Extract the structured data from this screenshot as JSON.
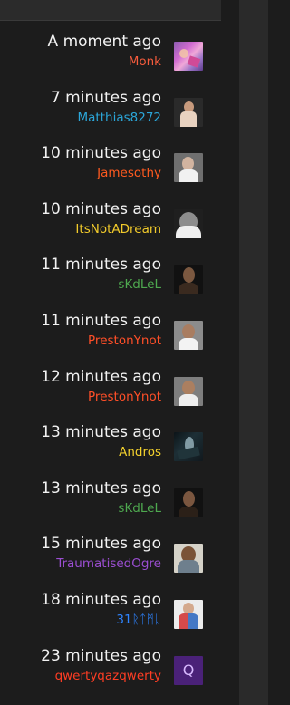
{
  "feed": [
    {
      "time": "A moment ago",
      "user": "Monk",
      "user_color": "#f45b3c",
      "avatar_icon": "monk-avatar-icon"
    },
    {
      "time": "7 minutes ago",
      "user": "Matthias8272",
      "user_color": "#2ba6d9",
      "avatar_icon": "matthias8272-avatar-icon"
    },
    {
      "time": "10 minutes ago",
      "user": "Jamesothy",
      "user_color": "#ff5a1f",
      "avatar_icon": "jamesothy-avatar-icon"
    },
    {
      "time": "10 minutes ago",
      "user": "ItsNotADream",
      "user_color": "#f2cb2b",
      "avatar_icon": "itsnotadream-avatar-icon"
    },
    {
      "time": "11 minutes ago",
      "user": "sKdLeL",
      "user_color": "#4ea84f",
      "avatar_icon": "skdlel-avatar-icon"
    },
    {
      "time": "11 minutes ago",
      "user": "PrestonYnot",
      "user_color": "#ff4f28",
      "avatar_icon": "prestonynot-avatar-icon"
    },
    {
      "time": "12 minutes ago",
      "user": "PrestonYnot",
      "user_color": "#ff4f28",
      "avatar_icon": "prestonynot-avatar-icon"
    },
    {
      "time": "13 minutes ago",
      "user": "Andros",
      "user_color": "#f3d12d",
      "avatar_icon": "andros-avatar-icon"
    },
    {
      "time": "13 minutes ago",
      "user": "sKdLeL",
      "user_color": "#4ea84f",
      "avatar_icon": "skdlel-avatar-icon"
    },
    {
      "time": "15 minutes ago",
      "user": "TraumatisedOgre",
      "user_color": "#9b4ed1",
      "avatar_icon": "traumatisedogre-avatar-icon"
    },
    {
      "time": "18 minutes ago",
      "user": "31ᚱᛏᛗᚳ",
      "user_color": "#2e84ff",
      "avatar_icon": "31rtmk-avatar-icon"
    },
    {
      "time": "23 minutes ago",
      "user": "qwertyqazqwerty",
      "user_color": "#ff3d24",
      "avatar_icon": "qwertyqazqwerty-avatar-icon",
      "avatar_text": "Q"
    }
  ]
}
